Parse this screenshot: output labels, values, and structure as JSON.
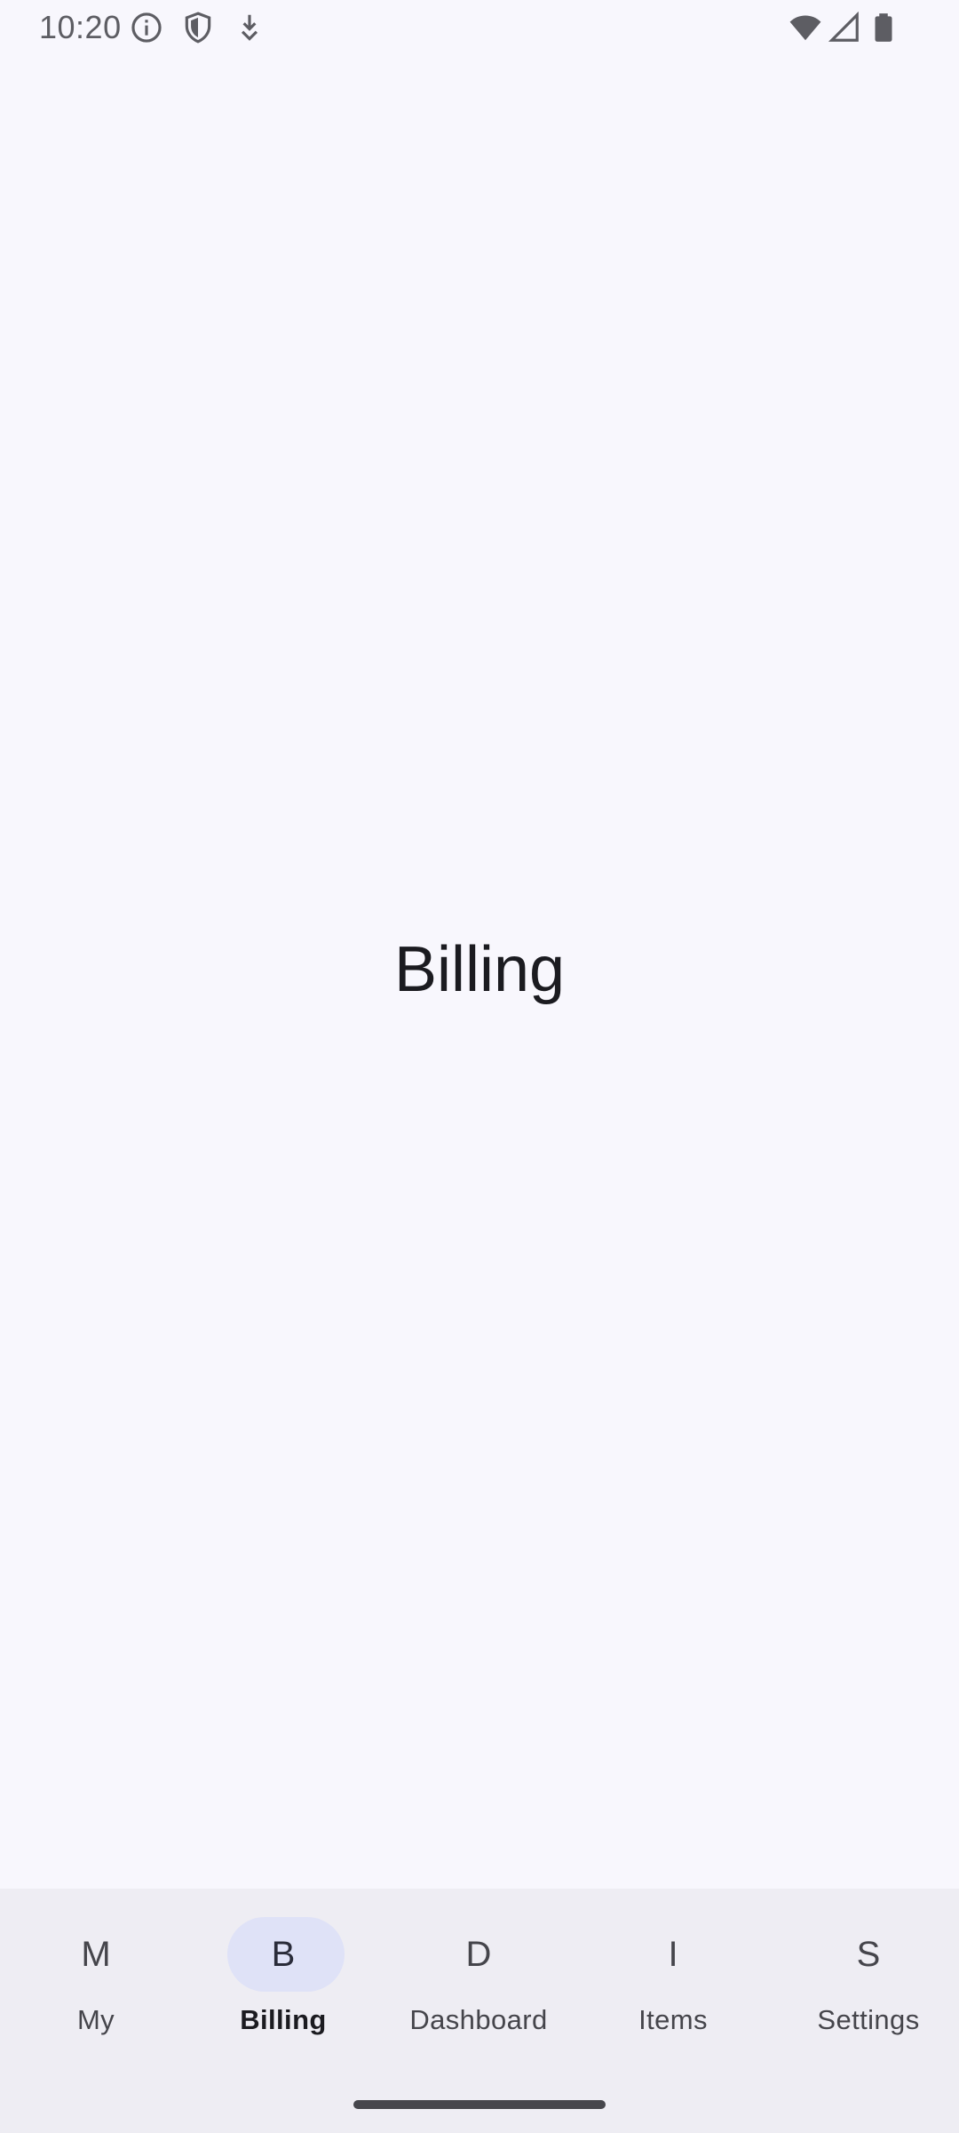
{
  "status_bar": {
    "time": "10:20",
    "icons": [
      "info-icon",
      "shield-icon",
      "download-icon",
      "wifi-icon",
      "signal-icon",
      "battery-icon"
    ]
  },
  "main": {
    "title": "Billing"
  },
  "bottom_nav": {
    "items": [
      {
        "letter": "M",
        "label": "My",
        "active": false
      },
      {
        "letter": "B",
        "label": "Billing",
        "active": true
      },
      {
        "letter": "D",
        "label": "Dashboard",
        "active": false
      },
      {
        "letter": "I",
        "label": "Items",
        "active": false
      },
      {
        "letter": "S",
        "label": "Settings",
        "active": false
      }
    ]
  },
  "colors": {
    "background": "#f8f7fd",
    "nav_background": "#eeedf3",
    "active_indicator": "#dfe2f7",
    "text": "#1b1b20"
  }
}
